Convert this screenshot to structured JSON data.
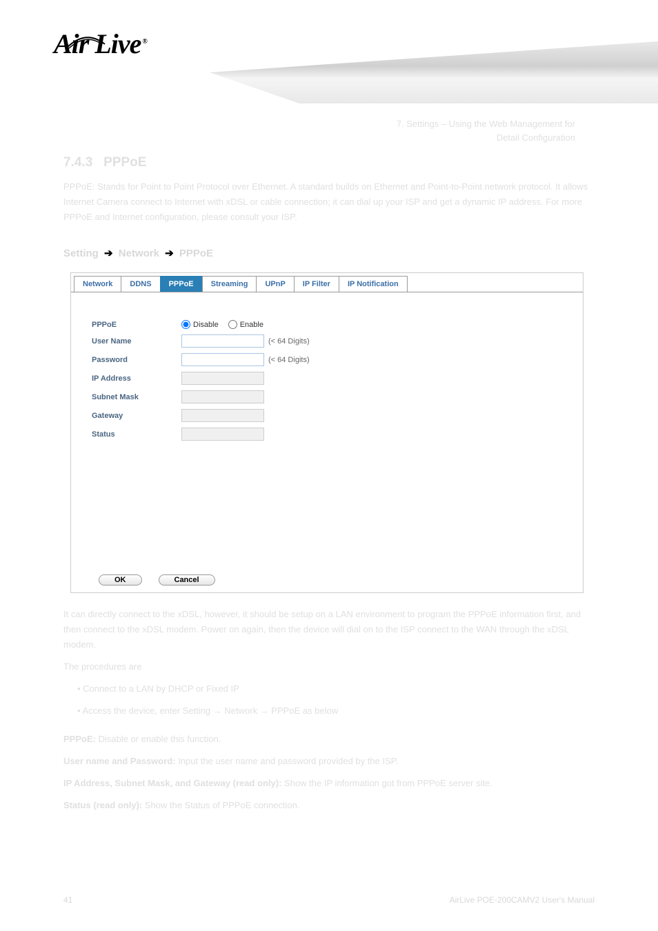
{
  "chapter_ref_line1": "7. Settings – Using the Web Management for",
  "chapter_ref_line2": "Detail Configuration",
  "section_number": "7.4.3",
  "section_name": "PPPoE",
  "section_intro": "PPPoE: Stands for Point to Point Protocol over Ethernet. A standard builds on Ethernet and Point-to-Point network protocol. It allows Internet Camera connect to Internet with xDSL or cable connection; it can dial up your ISP and get a dynamic IP address. For more PPPoE and Internet configuration, please consult your ISP.",
  "breadcrumb": {
    "a": "Setting",
    "b": "Network",
    "c": "PPPoE"
  },
  "tabs": [
    "Network",
    "DDNS",
    "PPPoE",
    "Streaming",
    "UPnP",
    "IP Filter",
    "IP Notification"
  ],
  "active_tab": "PPPoE",
  "form": {
    "pppoe_label": "PPPoE",
    "disable_label": "Disable",
    "enable_label": "Enable",
    "username_label": "User Name",
    "password_label": "Password",
    "ipaddress_label": "IP Address",
    "subnet_label": "Subnet Mask",
    "gateway_label": "Gateway",
    "status_label": "Status",
    "digits_hint": "(< 64 Digits)"
  },
  "buttons": {
    "ok": "OK",
    "cancel": "Cancel"
  },
  "desc": {
    "p1": "It can directly connect to the xDSL, however, it should be setup on a LAN environment to program the PPPoE information first, and then connect to the xDSL modem. Power on again, then the device will dial on to the ISP connect to the WAN through the xDSL modem.",
    "p2": "The procedures are",
    "steps": [
      "Connect to a LAN by DHCP or Fixed IP",
      "Access the device, enter Setting → Network → PPPoE as below"
    ],
    "pppoe_label": "PPPoE:",
    "pppoe_text": "Disable or enable this function.",
    "user_pass_label": "User name and Password:",
    "user_pass_text": "Input the user name and password provided by the ISP.",
    "ip_label": "IP Address, Subnet Mask, and Gateway (read only):",
    "ip_text": "Show the IP information got from PPPoE server site.",
    "status_label": "Status (read only):",
    "status_text": "Show the Status of PPPoE connection."
  },
  "footer": {
    "page": "41",
    "product": "AirLive POE-200CAMV2 User's Manual"
  }
}
